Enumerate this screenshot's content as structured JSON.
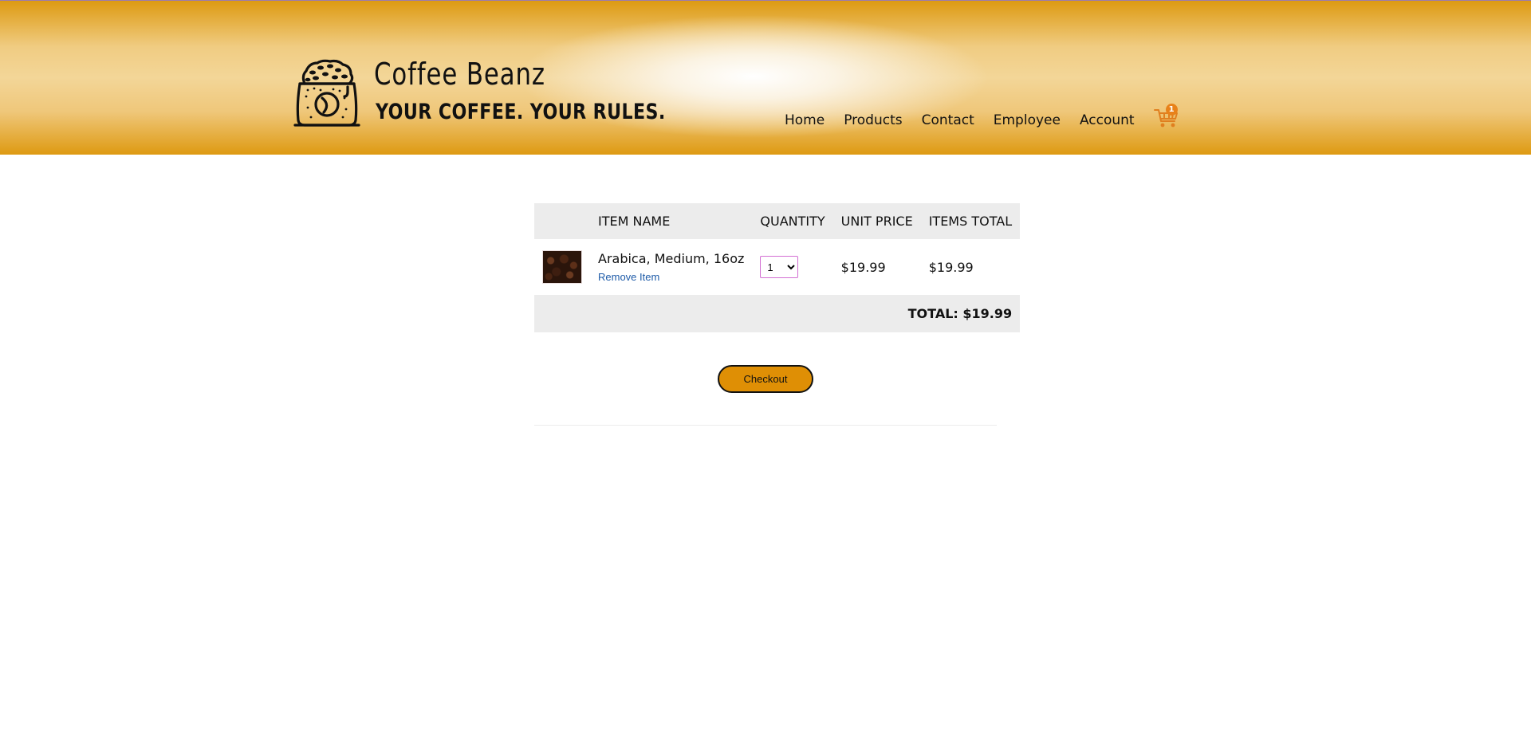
{
  "brand": {
    "name": "Coffee Beanz",
    "tagline": "YOUR COFFEE. YOUR RULES."
  },
  "nav": {
    "items": [
      "Home",
      "Products",
      "Contact",
      "Employee",
      "Account"
    ],
    "cart_icon": "shopping-cart-icon",
    "cart_count": "1"
  },
  "cart": {
    "headers": [
      "",
      "ITEM NAME",
      "QUANTITY",
      "UNIT PRICE",
      "ITEMS TOTAL"
    ],
    "items": [
      {
        "name": "Arabica, Medium, 16oz",
        "remove_label": "Remove Item",
        "quantity": "1",
        "unit_price": "$19.99",
        "items_total": "$19.99"
      }
    ],
    "total_label": "TOTAL: $19.99",
    "checkout_label": "Checkout"
  },
  "colors": {
    "header_gold": "#dd9a12",
    "checkout_button": "#df8f05",
    "link_blue": "#1e5ba8",
    "cart_badge": "#e8821a"
  }
}
